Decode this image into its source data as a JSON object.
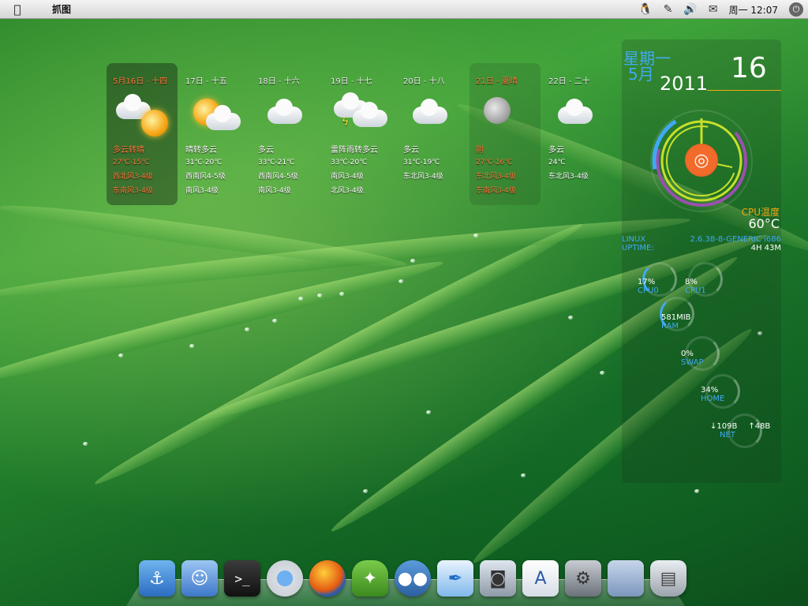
{
  "menubar": {
    "app_title": "抓图",
    "clock": "周一 12:07"
  },
  "weather": {
    "days": [
      {
        "date": "5月16日 - 十四",
        "desc": "多云转晴",
        "temp": "27℃-15℃",
        "wind1": "西北风3-4级",
        "wind2": "东南风3-4级",
        "icon": "partly-sunny-icon"
      },
      {
        "date": "17日 - 十五",
        "desc": "晴转多云",
        "temp": "31℃-20℃",
        "wind1": "西南风4-5级",
        "wind2": "南风3-4级",
        "icon": "sunny-cloudy-icon"
      },
      {
        "date": "18日 - 十六",
        "desc": "多云",
        "temp": "33℃-21℃",
        "wind1": "西南风4-5级",
        "wind2": "南风3-4级",
        "icon": "cloudy-icon"
      },
      {
        "date": "19日 - 十七",
        "desc": "雷阵雨转多云",
        "temp": "33℃-20℃",
        "wind1": "南风3-4级",
        "wind2": "北风3-4级",
        "icon": "thunderstorm-icon"
      },
      {
        "date": "20日 - 十八",
        "desc": "多云",
        "temp": "31℃-19℃",
        "wind1": "东北风3-4级",
        "wind2": "",
        "icon": "cloudy-icon"
      },
      {
        "date": "21日 - 夏晴",
        "desc": "阴",
        "temp": "27℃-16℃",
        "wind1": "东北风3-4级",
        "wind2": "东南风3-4级",
        "icon": "moon-icon"
      },
      {
        "date": "22日 - 二十",
        "desc": "多云",
        "temp": "24℃",
        "wind1": "东北风3-4级",
        "wind2": "",
        "icon": "cloudy-icon"
      }
    ]
  },
  "monitor": {
    "weekday": "星期一",
    "month": "5月",
    "year": "2011",
    "day_num": "16",
    "cpu_temp_label": "CPU温度",
    "cpu_temp": "60°C",
    "os_label": "LINUX",
    "kernel": "2.6.38-8-GENERIC i686",
    "uptime_label": "UPTIME:",
    "uptime": "4H 43M",
    "cpu0_val": "17%",
    "cpu0_lbl": "CPU0",
    "cpu1_val": "8%",
    "cpu1_lbl": "CPU1",
    "ram_val": "581MIB",
    "ram_lbl": "RAM",
    "swap_val": "0%",
    "swap_lbl": "SWAP",
    "home_val": "34%",
    "home_lbl": "HOME",
    "net_down": "↓109B",
    "net_up": "↑48B",
    "net_lbl": "NET"
  },
  "dock": {
    "items": [
      "anchor-icon",
      "finder-icon",
      "terminal-icon",
      "chrome-icon",
      "firefox-icon",
      "pidgin-icon",
      "people-icon",
      "feather-icon",
      "camera-icon",
      "text-editor-icon",
      "system-settings-icon",
      "folder-icon",
      "trash-icon"
    ]
  },
  "colors": {
    "accent_blue": "#3fa9f5",
    "accent_orange": "#f5a614",
    "forecast_highlight": "#ff7a3a"
  }
}
